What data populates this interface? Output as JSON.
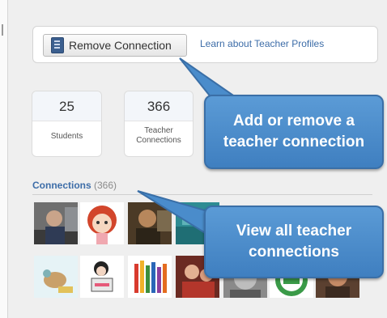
{
  "profile": {
    "remove_button": "Remove Connection",
    "learn_link": "Learn about Teacher Profiles"
  },
  "stats": [
    {
      "value": "25",
      "label": "Students"
    },
    {
      "value": "366",
      "label": "Teacher Connections"
    }
  ],
  "connections": {
    "title": "Connections",
    "count": "(366)"
  },
  "callouts": {
    "add_remove": "Add or remove a teacher connection",
    "view_all": "View all teacher connections"
  },
  "icons": {
    "remove": "profile-card-icon"
  },
  "colors": {
    "callout": "#4a8ccb",
    "link": "#3d6da8"
  }
}
